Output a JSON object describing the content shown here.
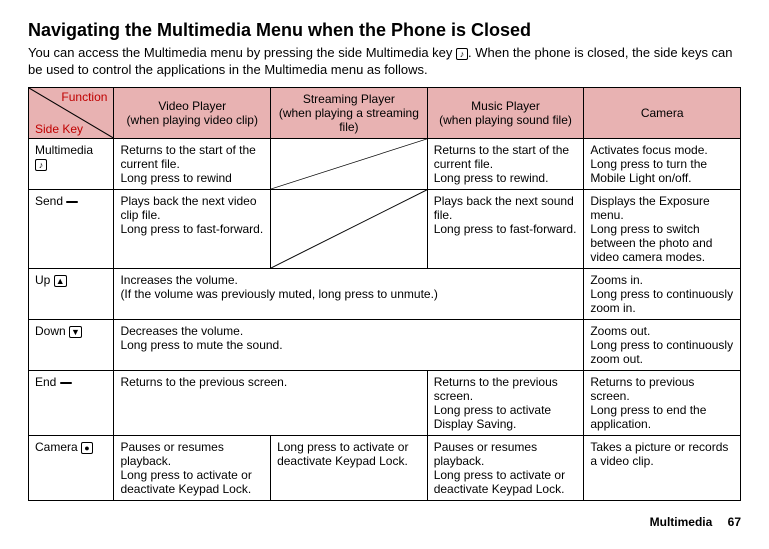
{
  "title": "Navigating the Multimedia Menu when the Phone is Closed",
  "intro_before_icon": "You can access the Multimedia menu by pressing the side Multimedia key ",
  "intro_after_icon": ". When the phone is closed, the side keys can be used to control the applications in the Multimedia menu as follows.",
  "multimedia_icon_glyph": "♪",
  "header": {
    "diag_top": "Function",
    "diag_bottom": "Side Key",
    "video": "Video Player\n(when playing video clip)",
    "stream": "Streaming Player\n(when playing a streaming file)",
    "music": "Music Player\n(when playing sound file)",
    "camera": "Camera"
  },
  "rows": {
    "multimedia": {
      "label": "Multimedia ",
      "icon": "♪",
      "video": "Returns to the start of the current file.\nLong press to rewind",
      "music": "Returns to the start of the current file.\nLong press to rewind.",
      "camera": "Activates focus mode.\nLong press to turn the Mobile Light on/off."
    },
    "send": {
      "label": "Send ",
      "icon": " ",
      "video": "Plays back the next video clip file.\nLong press to fast-forward.",
      "music": "Plays back the next sound file.\nLong press to fast-forward.",
      "camera": "Displays the Exposure menu.\nLong press to switch between the photo and video camera modes."
    },
    "up": {
      "label": "Up ",
      "icon": "▲",
      "merged": "Increases the volume.\n(If the volume was previously muted, long press to unmute.)",
      "camera": "Zooms in.\nLong press to continuously zoom in."
    },
    "down": {
      "label": "Down ",
      "icon": "▼",
      "merged": "Decreases the volume.\nLong press to mute the sound.",
      "camera": "Zooms out.\nLong press to continuously zoom out."
    },
    "end": {
      "label": "End ",
      "icon": " ",
      "merged2": "Returns to the previous screen.",
      "music": "Returns to the previous screen.\nLong press to activate Display Saving.",
      "camera": "Returns to previous screen.\nLong press to end the application."
    },
    "camera_row": {
      "label": "Camera ",
      "icon": "●",
      "video": "Pauses or resumes playback.\nLong press to activate or deactivate Keypad Lock.",
      "stream": "Long press to activate or deactivate Keypad Lock.",
      "music": "Pauses or resumes playback.\nLong press to activate or deactivate Keypad Lock.",
      "camera": "Takes a picture or records a video clip."
    }
  },
  "footer": {
    "section": "Multimedia",
    "page": "67"
  }
}
